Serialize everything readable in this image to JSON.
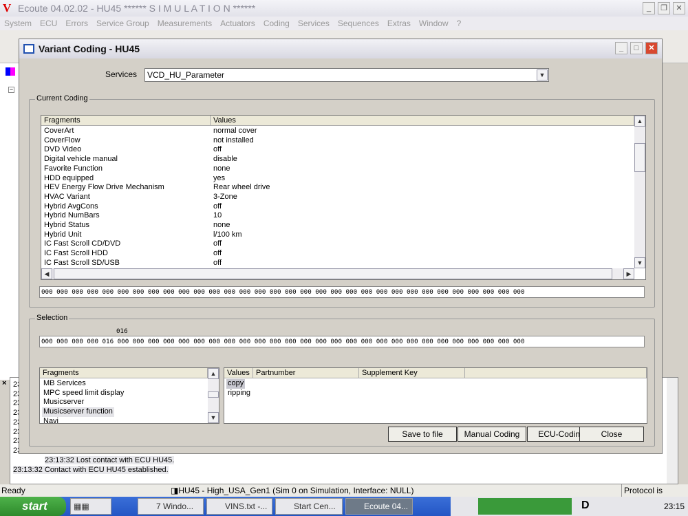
{
  "app": {
    "title": "Ecoute 04.02.02 - HU45 ****** S I M U L A T I O N ******",
    "logo": "V"
  },
  "menu": [
    "System",
    "ECU",
    "Errors",
    "Service Group",
    "Measurements",
    "Actuators",
    "Coding",
    "Services",
    "Sequences",
    "Extras",
    "Window",
    "?"
  ],
  "dialog": {
    "title": "Variant Coding - HU45",
    "services_label": "Services",
    "services_value": "VCD_HU_Parameter",
    "current_coding": {
      "label": "Current Coding",
      "columns": [
        "Fragments",
        "Values"
      ],
      "rows": [
        [
          "CoverArt",
          "normal cover"
        ],
        [
          "CoverFlow",
          "not installed"
        ],
        [
          "DVD Video",
          "off"
        ],
        [
          "Digital vehicle manual",
          "disable"
        ],
        [
          "Favorite Function",
          "none"
        ],
        [
          "HDD equipped",
          "yes"
        ],
        [
          "HEV Energy Flow Drive Mechanism",
          "Rear wheel drive"
        ],
        [
          "HVAC Variant",
          "3-Zone"
        ],
        [
          "Hybrid AvgCons",
          "off"
        ],
        [
          "Hybrid NumBars",
          "10"
        ],
        [
          "Hybrid Status",
          "none"
        ],
        [
          "Hybrid Unit",
          "l/100 km"
        ],
        [
          "IC Fast Scroll CD/DVD",
          "off"
        ],
        [
          "IC Fast Scroll HDD",
          "off"
        ],
        [
          "IC Fast Scroll SD/USB",
          "off"
        ]
      ],
      "hex": "000 000 000 000 000 000 000 000 000 000 000 000 000 000 000 000 000 000 000 000 000 000 000 000 000 000 000 000 000 000 000 000"
    },
    "selection": {
      "label": "Selection",
      "marker": "016",
      "hex": "000 000 000 000 016 000 000 000 000 000 000 000 000 000 000 000 000 000 000 000 000 000 000 000 000 000 000 000 000 000 000 000",
      "fragments_header": "Fragments",
      "fragments": [
        "MB Services",
        "MPC speed limit display",
        "Musicserver",
        "Musicserver function",
        "Navi"
      ],
      "selected_fragment": "Musicserver function",
      "value_columns": [
        "Values",
        "Partnumber",
        "Supplement Key"
      ],
      "values": [
        "copy",
        "ripping"
      ],
      "selected_value": "copy"
    },
    "buttons": {
      "save": "Save to file",
      "manual": "Manual Coding",
      "ecu": "ECU-Coding",
      "close": "Close"
    }
  },
  "log": {
    "lines": [
      "23:13:32 Lost contact with ECU HU45.",
      "23:13:32 Contact with ECU HU45 established."
    ],
    "stub": "23"
  },
  "status": {
    "left": "Ready",
    "middle": "HU45 - High_USA_Gen1 (Sim 0 on Simulation, Interface: NULL)",
    "right": "Protocol is running"
  },
  "taskbar": {
    "start": "start",
    "tasks": [
      "7 Windo...",
      "VINS.txt -...",
      "Start Cen...",
      "Ecoute 04..."
    ],
    "tray_letter": "D",
    "clock": "23:15"
  }
}
